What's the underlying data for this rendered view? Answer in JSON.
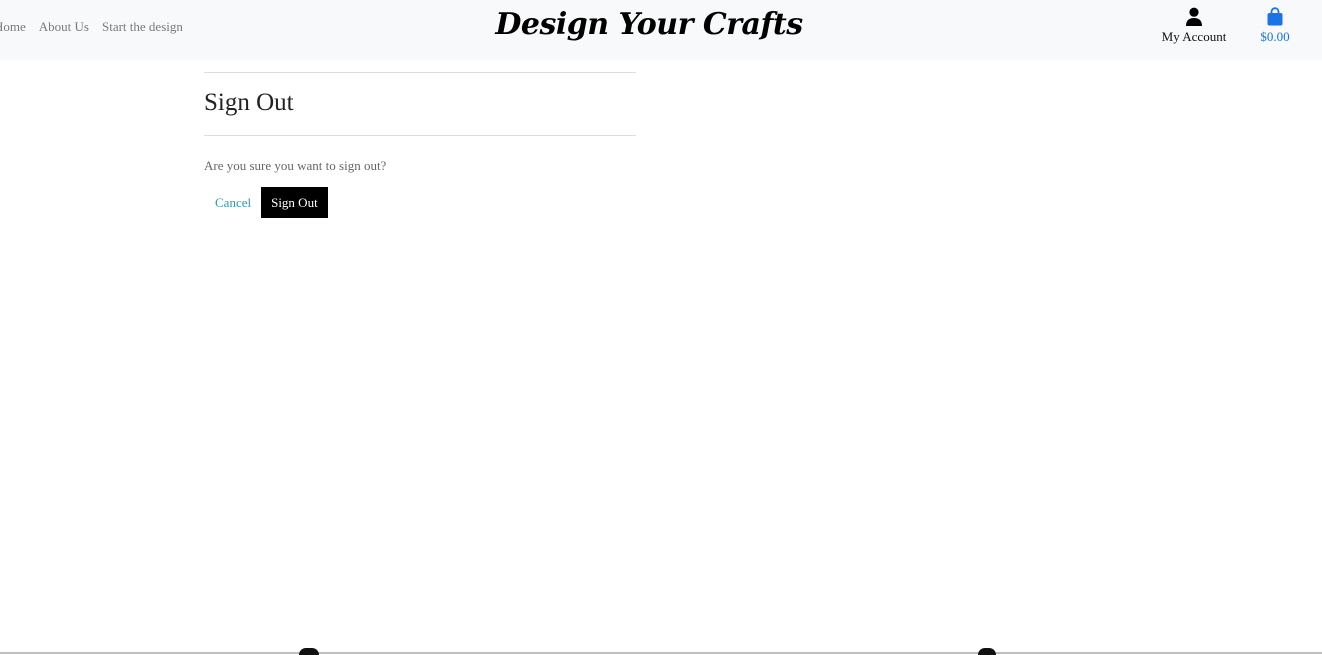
{
  "nav": {
    "links": [
      "Home",
      "About Us",
      "Start the design"
    ],
    "brand": "Design Your Crafts",
    "account_label": "My Account",
    "account_icon": "user-icon",
    "cart_total": "$0.00",
    "cart_icon": "shopping-bag-icon"
  },
  "main": {
    "title": "Sign Out",
    "question": "Are you sure you want to sign out?",
    "cancel_label": "Cancel",
    "signout_label": "Sign Out"
  },
  "colors": {
    "navbar_bg": "#f8f9fa",
    "accent_link": "#2a9bb5",
    "cart_blue": "#1a73e8",
    "button_bg": "#000000"
  }
}
